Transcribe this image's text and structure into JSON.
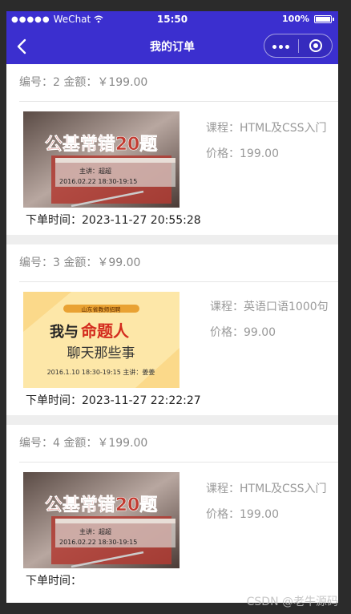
{
  "status": {
    "carrier": "WeChat",
    "time": "15:50",
    "battery": "100%"
  },
  "nav": {
    "title": "我的订单"
  },
  "orders": [
    {
      "head": "编号：2 金额：￥199.00",
      "course": "课程：HTML及CSS入门",
      "price": "价格：199.00",
      "time": "下单时间：2023-11-27 20:55:28",
      "image": {
        "title": "公基常错20题",
        "speaker": "主讲：超超",
        "date": "2016.02.22 18:30-19:15"
      }
    },
    {
      "head": "编号：3 金额：￥99.00",
      "course": "课程：英语口语1000句",
      "price": "价格：99.00",
      "time": "下单时间：2023-11-27 22:22:27",
      "image": {
        "tag": "山东省教师招聘",
        "line1a": "我与",
        "line1b": "命题人",
        "line2": "聊天那些事",
        "date": "2016.1.10 18:30-19:15 主讲：姜姜"
      }
    },
    {
      "head": "编号：4 金额：￥199.00",
      "course": "课程：HTML及CSS入门",
      "price": "价格：199.00",
      "time": "下单时间：",
      "image": {
        "title": "公基常错20题",
        "speaker": "主讲：超超",
        "date": "2016.02.22 18:30-19:15"
      }
    }
  ],
  "watermark": "CSDN @老牛源码"
}
